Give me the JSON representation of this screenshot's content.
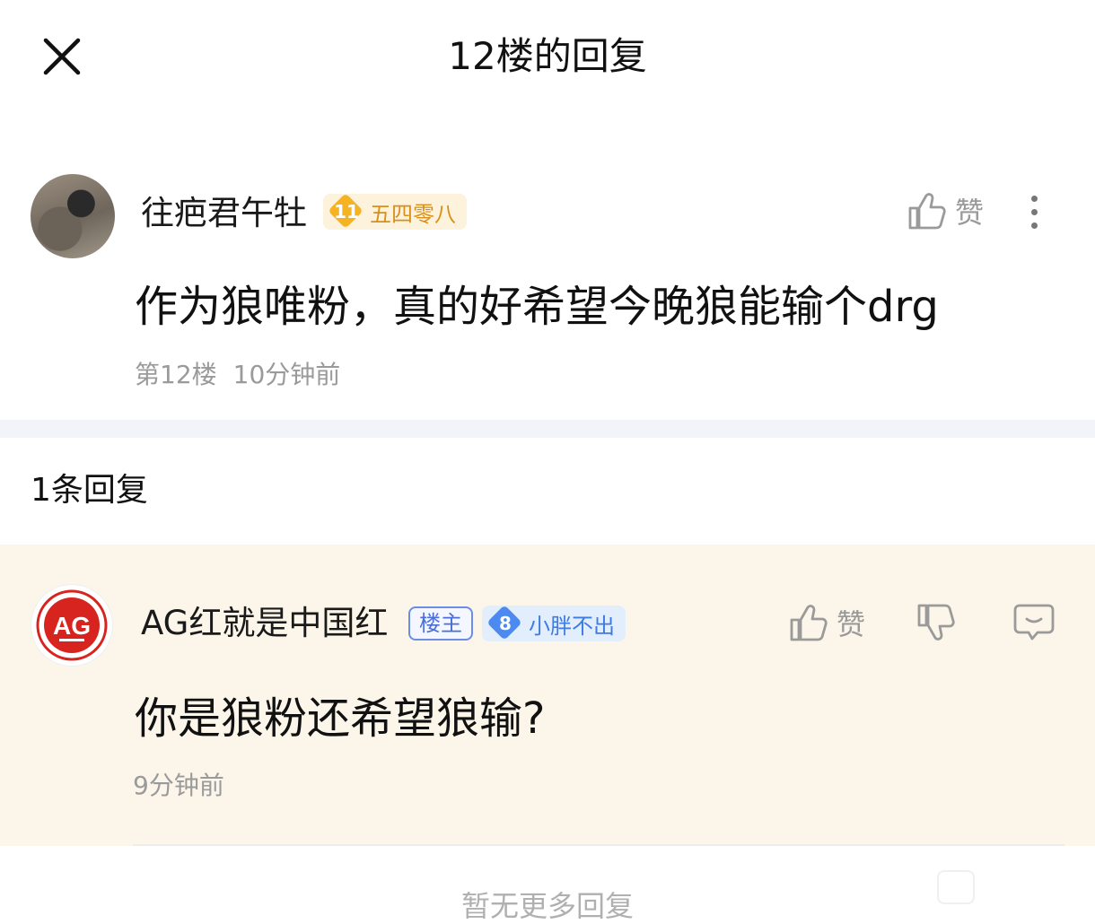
{
  "header": {
    "title": "12楼的回复"
  },
  "post": {
    "username": "往疤君午牡",
    "level": "11",
    "level_title": "五四零八",
    "like_label": "赞",
    "content": "作为狼唯粉，真的好希望今晚狼能输个drg",
    "floor": "第12楼",
    "time": "10分钟前"
  },
  "replies_header": {
    "count_label": "1条回复"
  },
  "reply": {
    "username": "AG红就是中国红",
    "owner_tag": "楼主",
    "level": "8",
    "level_title": "小胖不出",
    "like_label": "赞",
    "content": "你是狼粉还希望狼输?",
    "time": "9分钟前",
    "avatar_logo_text": "AG"
  },
  "footer": {
    "no_more": "暂无更多回复"
  },
  "colors": {
    "gold_gem": "#f5b323",
    "gold_badge_bg": "#fdf3dc",
    "gold_text": "#d9901a",
    "blue_gem": "#4d8af0",
    "blue_badge_bg": "#e3eefc",
    "blue_text": "#3d7be6",
    "reply_bg": "#fcf6ea",
    "ag_red": "#d8241f"
  }
}
